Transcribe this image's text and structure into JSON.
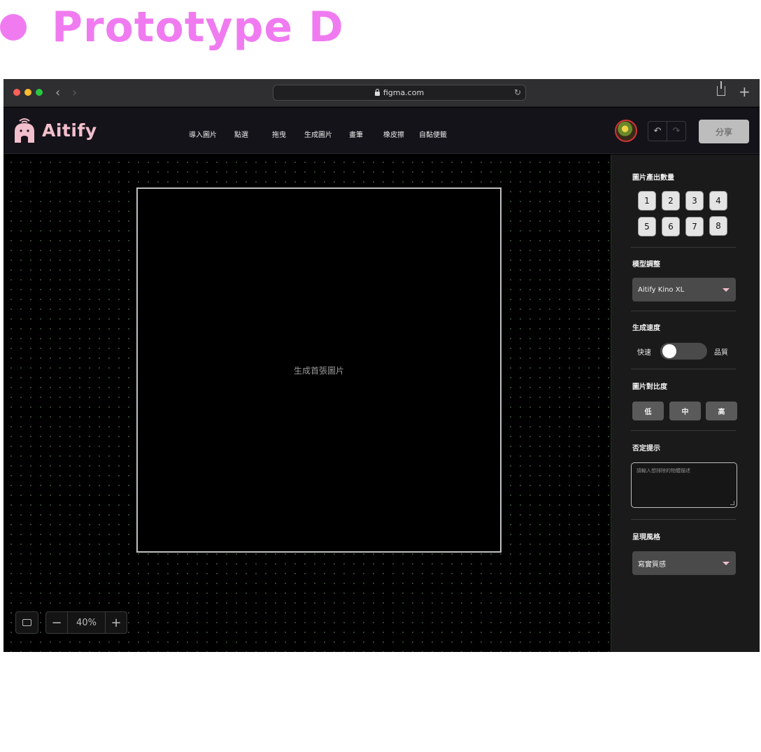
{
  "page_title": "Prototype D",
  "browser": {
    "url": "figma.com"
  },
  "app": {
    "logo_text": "Aitify",
    "tools": [
      "導入圖片",
      "點選",
      "拖曳",
      "生成圖片",
      "畫筆",
      "橡皮擦",
      "自黏便籤"
    ],
    "share_label": "分享"
  },
  "canvas": {
    "placeholder": "生成首張圖片",
    "zoom": "40%",
    "zoom_minus": "−",
    "zoom_plus": "+"
  },
  "panel": {
    "count_title": "圖片產出數量",
    "counts": [
      "1",
      "2",
      "3",
      "4",
      "5",
      "6",
      "7",
      "8"
    ],
    "model_title": "模型調整",
    "model_value": "Aitify Kino XL",
    "speed_title": "生成速度",
    "speed_left": "快速",
    "speed_right": "品質",
    "contrast_title": "圖片對比度",
    "contrast_options": [
      "低",
      "中",
      "高"
    ],
    "negative_title": "否定提示",
    "negative_placeholder": "請輸入想排除的物體描述",
    "style_title": "呈現風格",
    "style_value": "寫實質感"
  },
  "colors": {
    "accent_pink": "#f07bf0",
    "logo_pink": "#f2bfcc",
    "canvas_bg": "#000000",
    "panel_bg": "#1a1a1a"
  }
}
